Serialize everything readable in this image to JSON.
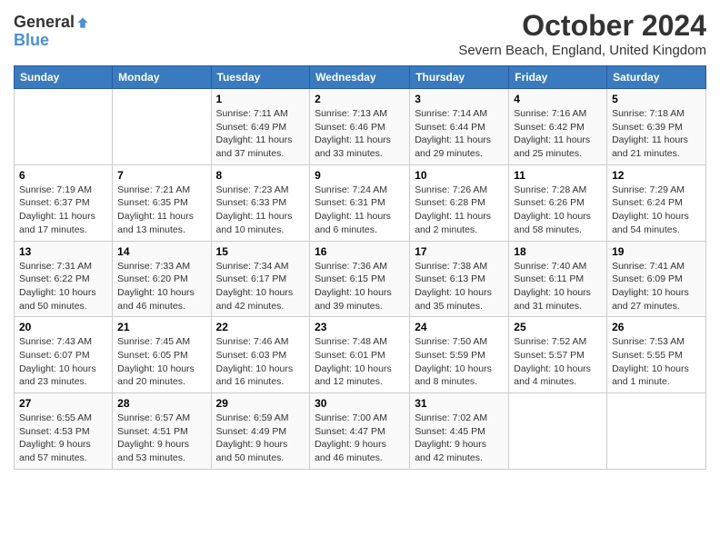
{
  "header": {
    "logo": {
      "general": "General",
      "blue": "Blue"
    },
    "title": "October 2024",
    "location": "Severn Beach, England, United Kingdom"
  },
  "weekdays": [
    "Sunday",
    "Monday",
    "Tuesday",
    "Wednesday",
    "Thursday",
    "Friday",
    "Saturday"
  ],
  "weeks": [
    [
      {
        "day": "",
        "sunrise": "",
        "sunset": "",
        "daylight": ""
      },
      {
        "day": "",
        "sunrise": "",
        "sunset": "",
        "daylight": ""
      },
      {
        "day": "1",
        "sunrise": "Sunrise: 7:11 AM",
        "sunset": "Sunset: 6:49 PM",
        "daylight": "Daylight: 11 hours and 37 minutes."
      },
      {
        "day": "2",
        "sunrise": "Sunrise: 7:13 AM",
        "sunset": "Sunset: 6:46 PM",
        "daylight": "Daylight: 11 hours and 33 minutes."
      },
      {
        "day": "3",
        "sunrise": "Sunrise: 7:14 AM",
        "sunset": "Sunset: 6:44 PM",
        "daylight": "Daylight: 11 hours and 29 minutes."
      },
      {
        "day": "4",
        "sunrise": "Sunrise: 7:16 AM",
        "sunset": "Sunset: 6:42 PM",
        "daylight": "Daylight: 11 hours and 25 minutes."
      },
      {
        "day": "5",
        "sunrise": "Sunrise: 7:18 AM",
        "sunset": "Sunset: 6:39 PM",
        "daylight": "Daylight: 11 hours and 21 minutes."
      }
    ],
    [
      {
        "day": "6",
        "sunrise": "Sunrise: 7:19 AM",
        "sunset": "Sunset: 6:37 PM",
        "daylight": "Daylight: 11 hours and 17 minutes."
      },
      {
        "day": "7",
        "sunrise": "Sunrise: 7:21 AM",
        "sunset": "Sunset: 6:35 PM",
        "daylight": "Daylight: 11 hours and 13 minutes."
      },
      {
        "day": "8",
        "sunrise": "Sunrise: 7:23 AM",
        "sunset": "Sunset: 6:33 PM",
        "daylight": "Daylight: 11 hours and 10 minutes."
      },
      {
        "day": "9",
        "sunrise": "Sunrise: 7:24 AM",
        "sunset": "Sunset: 6:31 PM",
        "daylight": "Daylight: 11 hours and 6 minutes."
      },
      {
        "day": "10",
        "sunrise": "Sunrise: 7:26 AM",
        "sunset": "Sunset: 6:28 PM",
        "daylight": "Daylight: 11 hours and 2 minutes."
      },
      {
        "day": "11",
        "sunrise": "Sunrise: 7:28 AM",
        "sunset": "Sunset: 6:26 PM",
        "daylight": "Daylight: 10 hours and 58 minutes."
      },
      {
        "day": "12",
        "sunrise": "Sunrise: 7:29 AM",
        "sunset": "Sunset: 6:24 PM",
        "daylight": "Daylight: 10 hours and 54 minutes."
      }
    ],
    [
      {
        "day": "13",
        "sunrise": "Sunrise: 7:31 AM",
        "sunset": "Sunset: 6:22 PM",
        "daylight": "Daylight: 10 hours and 50 minutes."
      },
      {
        "day": "14",
        "sunrise": "Sunrise: 7:33 AM",
        "sunset": "Sunset: 6:20 PM",
        "daylight": "Daylight: 10 hours and 46 minutes."
      },
      {
        "day": "15",
        "sunrise": "Sunrise: 7:34 AM",
        "sunset": "Sunset: 6:17 PM",
        "daylight": "Daylight: 10 hours and 42 minutes."
      },
      {
        "day": "16",
        "sunrise": "Sunrise: 7:36 AM",
        "sunset": "Sunset: 6:15 PM",
        "daylight": "Daylight: 10 hours and 39 minutes."
      },
      {
        "day": "17",
        "sunrise": "Sunrise: 7:38 AM",
        "sunset": "Sunset: 6:13 PM",
        "daylight": "Daylight: 10 hours and 35 minutes."
      },
      {
        "day": "18",
        "sunrise": "Sunrise: 7:40 AM",
        "sunset": "Sunset: 6:11 PM",
        "daylight": "Daylight: 10 hours and 31 minutes."
      },
      {
        "day": "19",
        "sunrise": "Sunrise: 7:41 AM",
        "sunset": "Sunset: 6:09 PM",
        "daylight": "Daylight: 10 hours and 27 minutes."
      }
    ],
    [
      {
        "day": "20",
        "sunrise": "Sunrise: 7:43 AM",
        "sunset": "Sunset: 6:07 PM",
        "daylight": "Daylight: 10 hours and 23 minutes."
      },
      {
        "day": "21",
        "sunrise": "Sunrise: 7:45 AM",
        "sunset": "Sunset: 6:05 PM",
        "daylight": "Daylight: 10 hours and 20 minutes."
      },
      {
        "day": "22",
        "sunrise": "Sunrise: 7:46 AM",
        "sunset": "Sunset: 6:03 PM",
        "daylight": "Daylight: 10 hours and 16 minutes."
      },
      {
        "day": "23",
        "sunrise": "Sunrise: 7:48 AM",
        "sunset": "Sunset: 6:01 PM",
        "daylight": "Daylight: 10 hours and 12 minutes."
      },
      {
        "day": "24",
        "sunrise": "Sunrise: 7:50 AM",
        "sunset": "Sunset: 5:59 PM",
        "daylight": "Daylight: 10 hours and 8 minutes."
      },
      {
        "day": "25",
        "sunrise": "Sunrise: 7:52 AM",
        "sunset": "Sunset: 5:57 PM",
        "daylight": "Daylight: 10 hours and 4 minutes."
      },
      {
        "day": "26",
        "sunrise": "Sunrise: 7:53 AM",
        "sunset": "Sunset: 5:55 PM",
        "daylight": "Daylight: 10 hours and 1 minute."
      }
    ],
    [
      {
        "day": "27",
        "sunrise": "Sunrise: 6:55 AM",
        "sunset": "Sunset: 4:53 PM",
        "daylight": "Daylight: 9 hours and 57 minutes."
      },
      {
        "day": "28",
        "sunrise": "Sunrise: 6:57 AM",
        "sunset": "Sunset: 4:51 PM",
        "daylight": "Daylight: 9 hours and 53 minutes."
      },
      {
        "day": "29",
        "sunrise": "Sunrise: 6:59 AM",
        "sunset": "Sunset: 4:49 PM",
        "daylight": "Daylight: 9 hours and 50 minutes."
      },
      {
        "day": "30",
        "sunrise": "Sunrise: 7:00 AM",
        "sunset": "Sunset: 4:47 PM",
        "daylight": "Daylight: 9 hours and 46 minutes."
      },
      {
        "day": "31",
        "sunrise": "Sunrise: 7:02 AM",
        "sunset": "Sunset: 4:45 PM",
        "daylight": "Daylight: 9 hours and 42 minutes."
      },
      {
        "day": "",
        "sunrise": "",
        "sunset": "",
        "daylight": ""
      },
      {
        "day": "",
        "sunrise": "",
        "sunset": "",
        "daylight": ""
      }
    ]
  ]
}
